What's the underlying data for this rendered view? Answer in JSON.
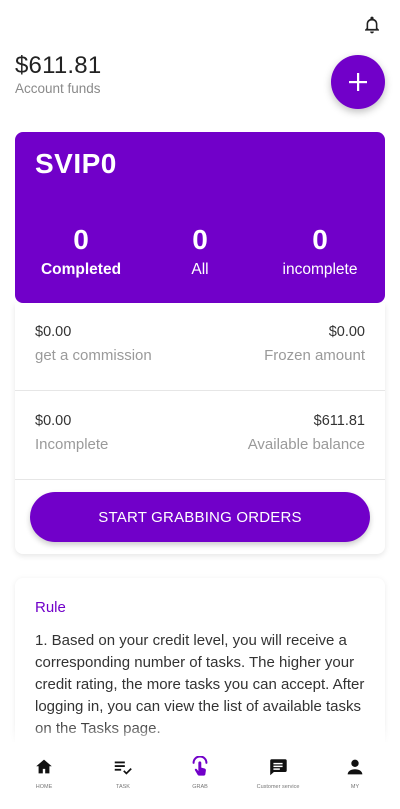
{
  "header": {
    "bell_icon": "bell-icon"
  },
  "account": {
    "amount": "$611.81",
    "label": "Account funds",
    "add_icon": "plus-icon"
  },
  "vip": {
    "level": "SVIP0",
    "stats": [
      {
        "value": "0",
        "label": "Completed"
      },
      {
        "value": "0",
        "label": "All"
      },
      {
        "value": "0",
        "label": "incomplete"
      }
    ]
  },
  "summary": {
    "commission_value": "$0.00",
    "commission_label": "get a commission",
    "frozen_value": "$0.00",
    "frozen_label": "Frozen amount",
    "incomplete_value": "$0.00",
    "incomplete_label": "Incomplete",
    "available_value": "$611.81",
    "available_label": "Available balance"
  },
  "actions": {
    "grab_label": "START GRABBING ORDERS"
  },
  "rule": {
    "title": "Rule",
    "text": "1. Based on your credit level, you will receive a corresponding number of tasks. The higher your credit rating, the more tasks you can accept. After logging in, you can view the list of available tasks on the Tasks page."
  },
  "nav": {
    "items": [
      {
        "label": "HOME",
        "icon": "home-icon"
      },
      {
        "label": "TASK",
        "icon": "task-list-icon"
      },
      {
        "label": "GRAB",
        "icon": "grab-icon"
      },
      {
        "label": "Customer service",
        "icon": "chat-icon"
      },
      {
        "label": "MY",
        "icon": "person-icon"
      }
    ]
  },
  "colors": {
    "accent": "#7100c9",
    "muted": "#9a9a9a"
  }
}
